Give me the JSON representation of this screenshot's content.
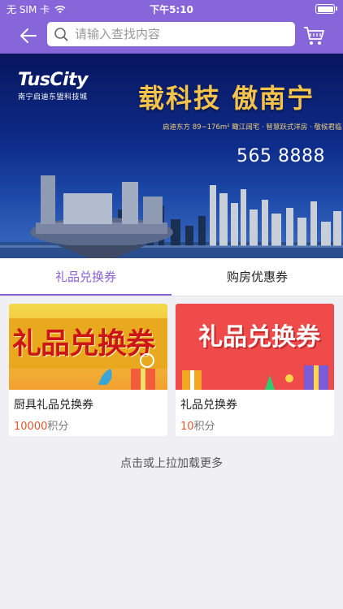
{
  "status_bar": {
    "carrier": "无 SIM 卡",
    "time": "下午5:10"
  },
  "search": {
    "placeholder": "请输入查找内容"
  },
  "banner": {
    "logo": "TusCity",
    "logo_sub": "南宁启迪东盟科技城",
    "headline": "载科技 傲南宁",
    "tagline": "启迪东方 89~176m² 瞰江阔宅 · 智慧跃式洋房 · 敬候君临",
    "phone": "565 8888"
  },
  "tabs": [
    {
      "label": "礼品兑换券",
      "active": true
    },
    {
      "label": "购房优惠券",
      "active": false
    }
  ],
  "items": [
    {
      "image_text": "礼品兑换券",
      "title": "厨具礼品兑换券",
      "points": "10000",
      "unit": "积分"
    },
    {
      "image_text": "礼品兑换券",
      "title": "礼品兑换券",
      "points": "10",
      "unit": "积分"
    }
  ],
  "load_more": "点击或上拉加载更多",
  "colors": {
    "accent": "#8666d8",
    "active_tab": "#8a5fd6",
    "points": "#e8542a"
  }
}
